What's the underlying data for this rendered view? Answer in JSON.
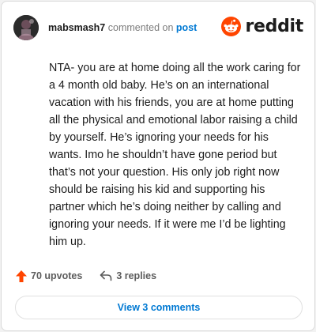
{
  "comment": {
    "username": "mabsmash7",
    "action_text": "commented on",
    "post_link": "post",
    "body": "NTA- you are at home doing all the work caring for a 4 month old baby. He’s on an international vacation with his friends, you are at home putting all the physical and emotional labor raising a child by yourself. He’s ignoring your needs for his wants. Imo he shouldn’t have gone period but that’s not your question. His only job right now should be raising his kid and supporting his partner which he’s doing neither by calling and ignoring your needs. If it were me I’d be lighting him up.",
    "upvotes": "70 upvotes",
    "replies": "3 replies"
  },
  "brand": {
    "name": "reddit",
    "icon": "reddit-logo-icon",
    "color": "#ff4500"
  },
  "view_comments_label": "View 3 comments",
  "colors": {
    "upvote": "#ff4500",
    "link": "#0079d3",
    "text": "#1c1c1c",
    "muted": "#7c7c7c"
  }
}
